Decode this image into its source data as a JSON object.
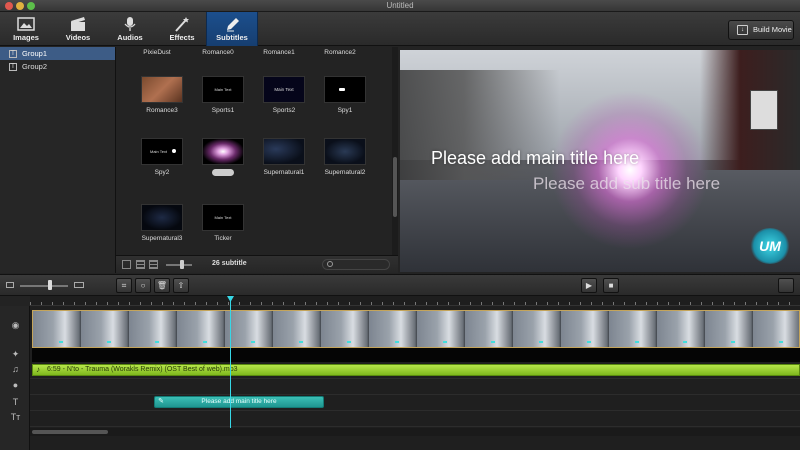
{
  "window": {
    "title": "Untitled"
  },
  "toolbar": {
    "tabs": [
      {
        "label": "Images",
        "icon": "image-icon"
      },
      {
        "label": "Videos",
        "icon": "clapperboard-icon"
      },
      {
        "label": "Audios",
        "icon": "microphone-icon"
      },
      {
        "label": "Effects",
        "icon": "magic-wand-icon"
      },
      {
        "label": "Subtitles",
        "icon": "pen-icon",
        "active": true
      }
    ],
    "build_label": "Build Movie"
  },
  "groups": [
    {
      "label": "Group1",
      "selected": true
    },
    {
      "label": "Group2",
      "selected": false
    }
  ],
  "library": {
    "top_labels": [
      "PixieDust",
      "Romance0",
      "Romance1",
      "Romance2"
    ],
    "items": [
      {
        "label": "Romance3",
        "thumb_text": ""
      },
      {
        "label": "Sports1",
        "thumb_text": "Main Text"
      },
      {
        "label": "Sports2",
        "thumb_text": "Main Text"
      },
      {
        "label": "Spy1",
        "thumb_text": ""
      },
      {
        "label": "Spy2",
        "thumb_text": "Main Text"
      },
      {
        "label": "",
        "thumb_text": ""
      },
      {
        "label": "Supernatural1",
        "thumb_text": ""
      },
      {
        "label": "Supernatural2",
        "thumb_text": ""
      },
      {
        "label": "Supernatural3",
        "thumb_text": ""
      },
      {
        "label": "Ticker",
        "thumb_text": "Main Text"
      }
    ],
    "count_label": "26 subtitle"
  },
  "preview": {
    "main_title": "Please add main title here",
    "sub_title": "Please add sub title here",
    "logo_text": "UM"
  },
  "timeline": {
    "audio_label": "6:59 - N'to - Trauma (Worakls Remix) (OST Best of web).mp3",
    "subtitle_clip_label": "Please add main title here"
  },
  "colors": {
    "accent_tab": "#1c4f8d",
    "selection": "#3d5c86",
    "audio_track": "#9fd435",
    "subtitle_clip": "#2aaea6",
    "playhead": "#37d7e6"
  }
}
